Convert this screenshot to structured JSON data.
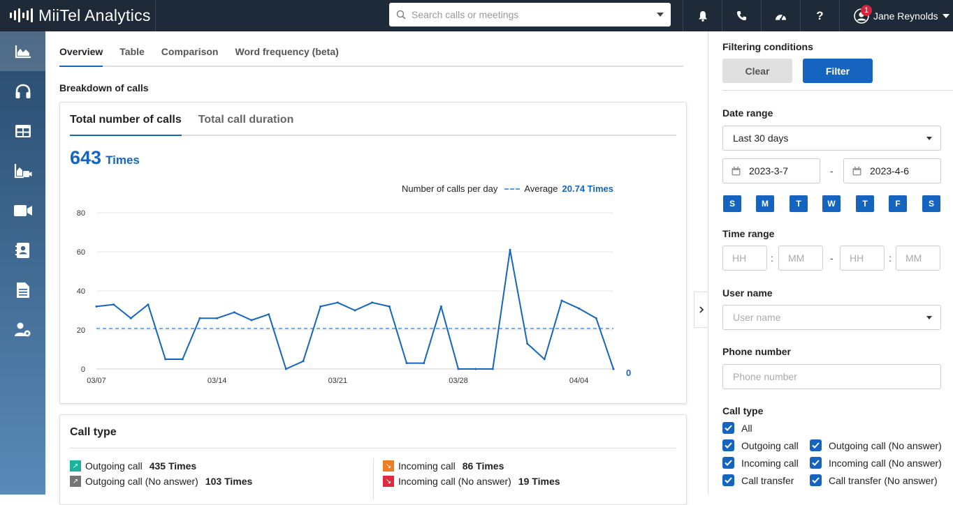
{
  "app": {
    "name": "MiiTel Analytics"
  },
  "search": {
    "placeholder": "Search calls or meetings"
  },
  "user": {
    "name": "Jane Reynolds",
    "notification_count": "1"
  },
  "tabs": [
    "Overview",
    "Table",
    "Comparison",
    "Word frequency (beta)"
  ],
  "breakdown": {
    "title": "Breakdown of calls",
    "tabs": [
      "Total number of calls",
      "Total call duration"
    ],
    "total_value": "643",
    "total_unit": "Times",
    "legend_label": "Number of calls per day",
    "average_label": "Average",
    "average_value": "20.74 Times",
    "last_value_label": "0"
  },
  "chart_data": {
    "type": "line",
    "title": "",
    "xlabel": "",
    "ylabel": "",
    "ylim": [
      0,
      80
    ],
    "yticks": [
      0,
      20,
      40,
      60,
      80
    ],
    "xtick_labels": [
      "03/07",
      "03/14",
      "03/21",
      "03/28",
      "04/04"
    ],
    "x": [
      "03/07",
      "03/08",
      "03/09",
      "03/10",
      "03/11",
      "03/12",
      "03/13",
      "03/14",
      "03/15",
      "03/16",
      "03/17",
      "03/18",
      "03/19",
      "03/20",
      "03/21",
      "03/22",
      "03/23",
      "03/24",
      "03/25",
      "03/26",
      "03/27",
      "03/28",
      "03/29",
      "03/30",
      "03/31",
      "04/01",
      "04/02",
      "04/03",
      "04/04",
      "04/05",
      "04/06"
    ],
    "series": [
      {
        "name": "Number of calls per day",
        "values": [
          32,
          33,
          26,
          33,
          5,
          5,
          26,
          26,
          29,
          25,
          28,
          0,
          4,
          32,
          34,
          30,
          34,
          32,
          3,
          3,
          32,
          0,
          0,
          0,
          61,
          13,
          5,
          35,
          31,
          26,
          0
        ],
        "color": "#1565c0"
      }
    ],
    "average": 20.74,
    "average_color": "#5a9ae0",
    "grid": true
  },
  "call_type": {
    "title": "Call type",
    "items": [
      {
        "label": "Outgoing call",
        "value": "435 Times",
        "color": "#1bb39a"
      },
      {
        "label": "Outgoing call (No answer)",
        "value": "103 Times",
        "color": "#757575"
      },
      {
        "label": "Incoming call",
        "value": "86 Times",
        "color": "#f07d22"
      },
      {
        "label": "Incoming call (No answer)",
        "value": "19 Times",
        "color": "#e0283e"
      }
    ]
  },
  "panel": {
    "title": "Filtering conditions",
    "clear_label": "Clear",
    "filter_label": "Filter",
    "date_range_label": "Date range",
    "date_range_value": "Last 30 days",
    "date_from": "2023-3-7",
    "date_to": "2023-4-6",
    "days": [
      "S",
      "M",
      "T",
      "W",
      "T",
      "F",
      "S"
    ],
    "time_range_label": "Time range",
    "time_placeholders": [
      "HH",
      "MM",
      "HH",
      "MM"
    ],
    "user_name_label": "User name",
    "user_name_placeholder": "User name",
    "phone_label": "Phone number",
    "phone_placeholder": "Phone number",
    "call_type_label": "Call type",
    "checkboxes": [
      "All",
      "Outgoing call",
      "Outgoing call (No answer)",
      "Incoming call",
      "Incoming call (No answer)",
      "Call transfer",
      "Call transfer (No answer)"
    ]
  }
}
